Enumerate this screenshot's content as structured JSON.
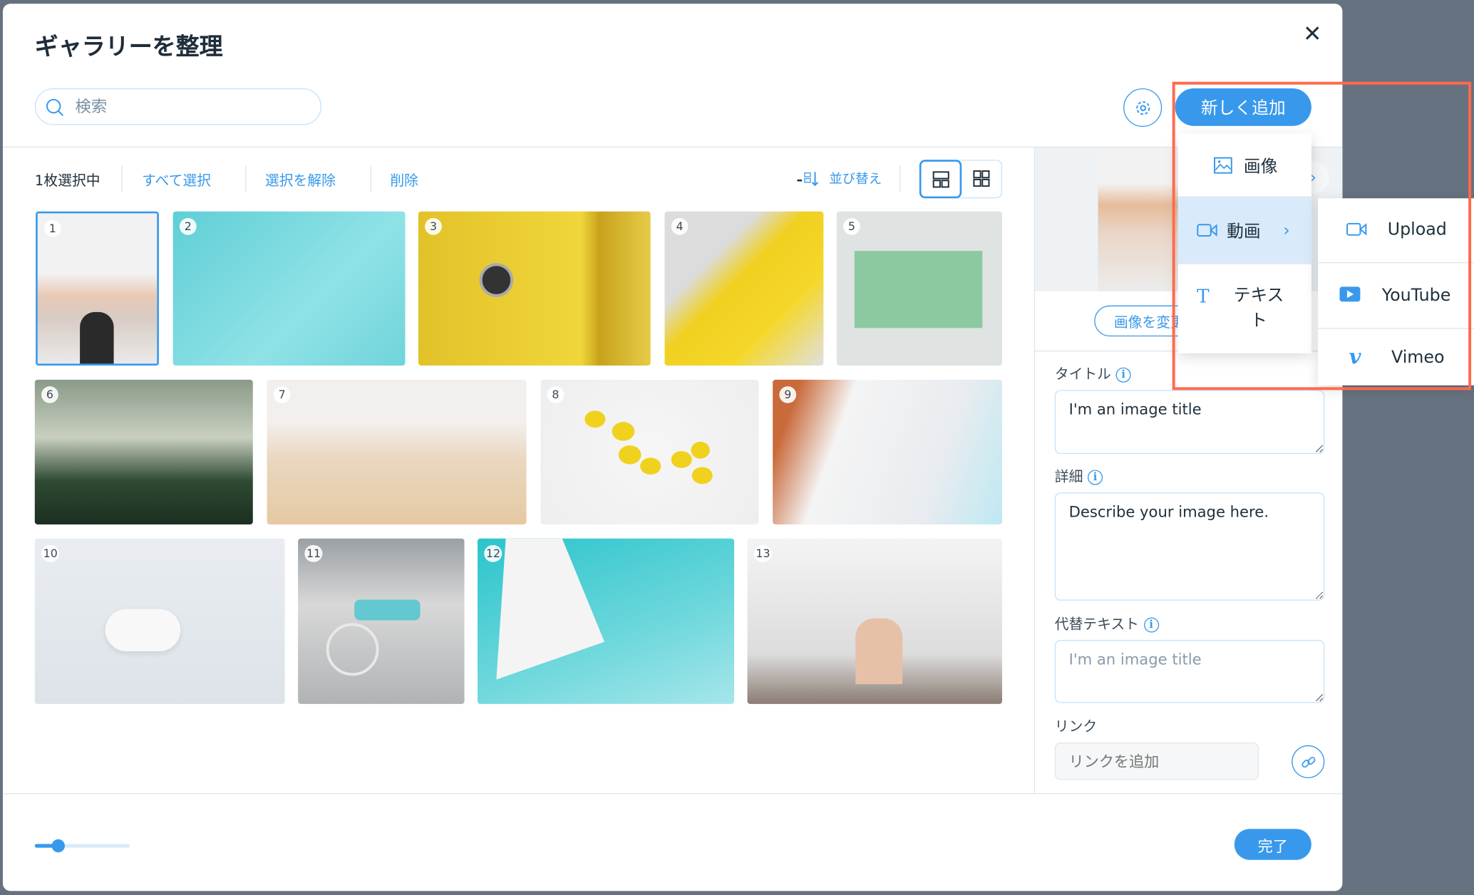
{
  "header": {
    "title": "ギャラリーを整理",
    "close_label": "✕",
    "search_placeholder": "検索",
    "add_new_label": "新しく追加"
  },
  "toolbar": {
    "selected_count": "1枚選択中",
    "select_all": "すべて選択",
    "deselect": "選択を解除",
    "delete": "削除",
    "sort": "並び替え",
    "view_mode": "masonry"
  },
  "tiles": [
    "1",
    "2",
    "3",
    "4",
    "5",
    "6",
    "7",
    "8",
    "9",
    "10",
    "11",
    "12",
    "13"
  ],
  "selected_tile": "1",
  "side_panel": {
    "change_image": "画像を変更",
    "title_label": "タイトル",
    "title_value": "I'm an image title",
    "description_label": "詳細",
    "description_value": "Describe your image here.",
    "alt_label": "代替テキスト",
    "alt_placeholder": "I'm an image title",
    "link_label": "リンク",
    "link_placeholder": "リンクを追加"
  },
  "add_menu": {
    "items": [
      {
        "label": "画像",
        "icon": "image-icon"
      },
      {
        "label": "動画",
        "icon": "video-icon"
      },
      {
        "label": "テキスト",
        "icon": "text-icon"
      }
    ],
    "video_submenu": [
      {
        "label": "Upload",
        "icon": "video-upload-icon"
      },
      {
        "label": "YouTube",
        "icon": "youtube-icon"
      },
      {
        "label": "Vimeo",
        "icon": "vimeo-icon"
      }
    ]
  },
  "footer": {
    "zoom_slider_percent": 25,
    "done_label": "完了"
  },
  "colors": {
    "accent": "#3899ec",
    "highlight": "#ff6a4d",
    "menu_active": "#d9ebfb",
    "backdrop": "#66727f"
  }
}
